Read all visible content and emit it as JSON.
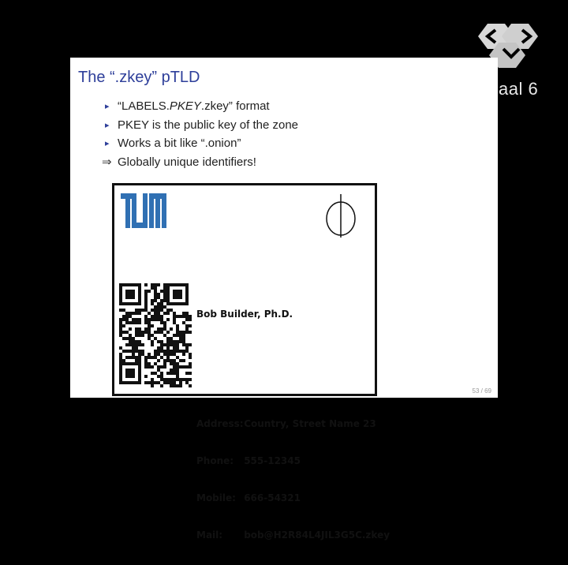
{
  "channel": {
    "logo_icon": "channel-logo-icon",
    "text": "aal 6"
  },
  "slide": {
    "title": "The “.zkey” pTLD",
    "bullets": [
      {
        "marker": "▸",
        "pre": "“LABELS.",
        "em": "PKEY",
        "post": ".zkey” format"
      },
      {
        "marker": "▸",
        "pre": "PKEY is the public key of the zone",
        "em": "",
        "post": ""
      },
      {
        "marker": "▸",
        "pre": "Works a bit like “.onion”",
        "em": "",
        "post": ""
      },
      {
        "marker": "⇒",
        "pre": "Globally unique identifiers!",
        "em": "",
        "post": ""
      }
    ],
    "page_number": "53 / 69"
  },
  "card": {
    "logo_text": "TUM",
    "name": "Bob Builder, Ph.D.",
    "address_label": "Address:",
    "address_value": "Country, Street Name 23",
    "phone_label": "Phone:",
    "phone_value": "555-12345",
    "mobile_label": "Mobile:",
    "mobile_value": "666-54321",
    "mail_label": "Mail:",
    "mail_value": "bob@H2R84L4JIL3G5C.zkey"
  },
  "colors": {
    "title": "#2e3f9a",
    "tum_blue": "#3070b3",
    "background": "#000000"
  }
}
